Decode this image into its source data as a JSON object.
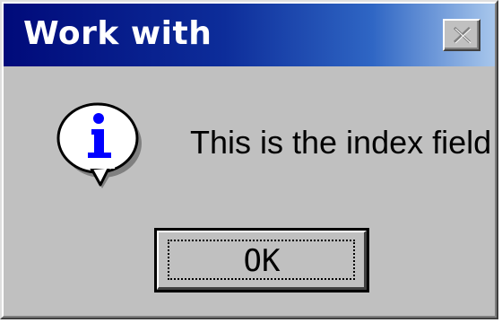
{
  "dialog": {
    "title": "Work with",
    "message": "This is the index field",
    "ok_label": "OK",
    "icon": "info-icon"
  },
  "colors": {
    "title_gradient_start": "#000a7a",
    "title_gradient_end": "#a8c7ec",
    "window_face": "#c0c0c0",
    "icon_letter": "#0000ff"
  }
}
